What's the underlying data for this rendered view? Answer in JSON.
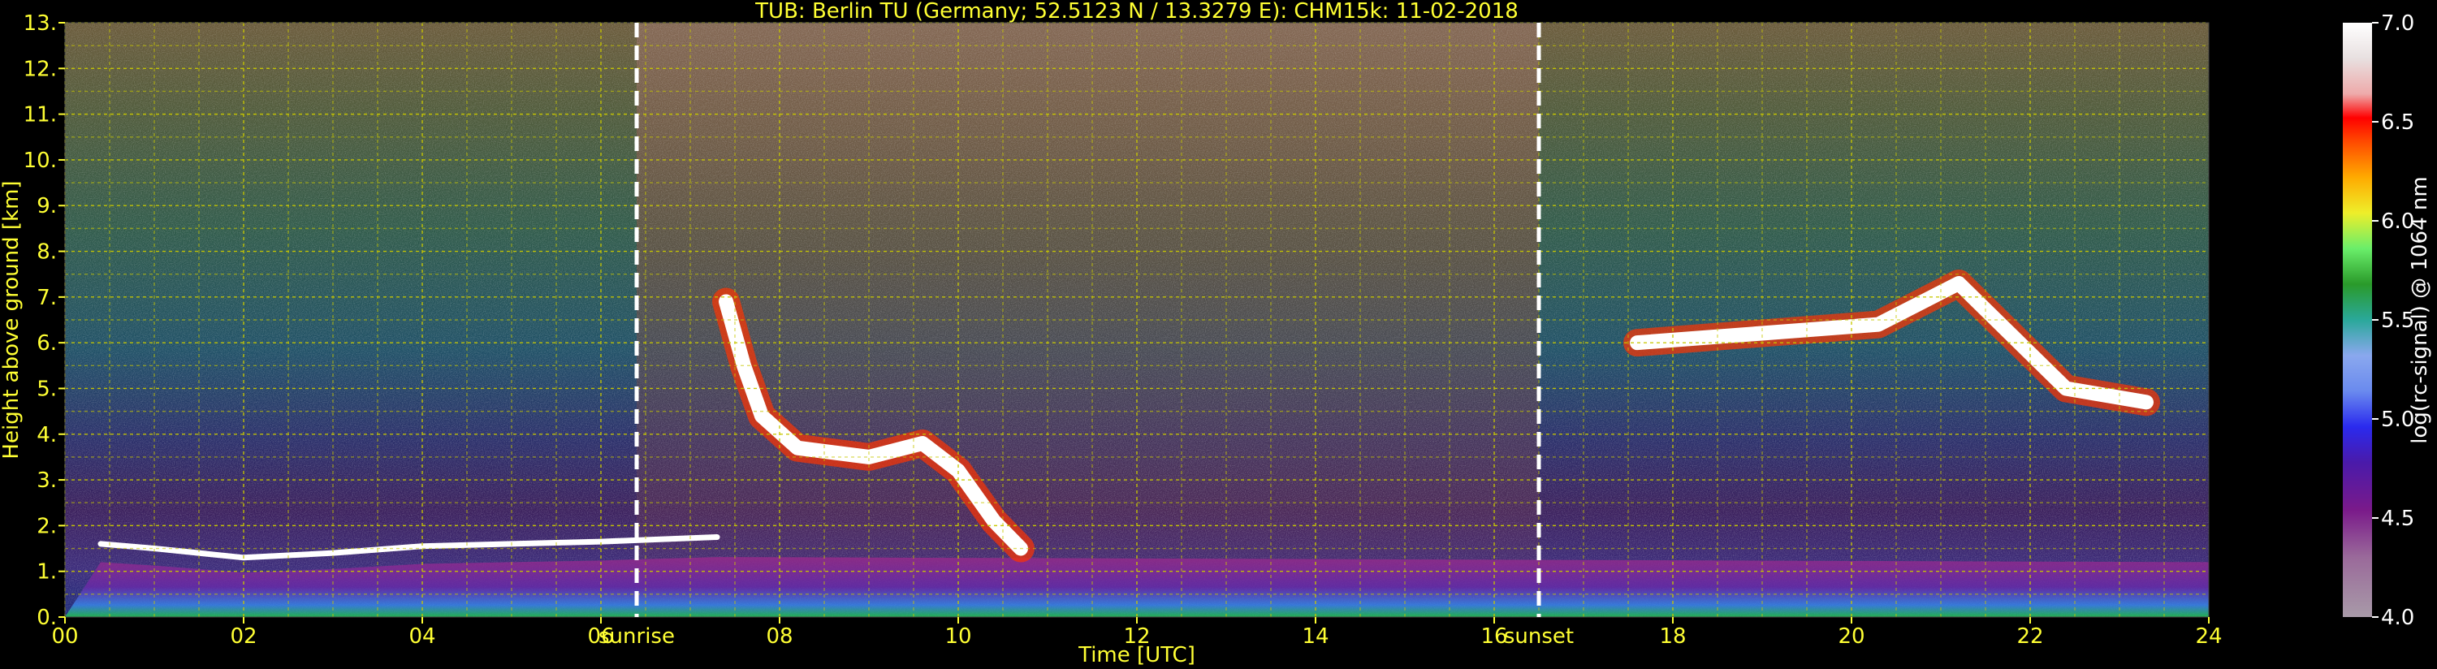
{
  "chart_data": {
    "type": "heatmap",
    "title": "TUB: Berlin TU (Germany; 52.5123 N / 13.3279 E):    CHM15k: 11-02-2018",
    "xlabel": "Time [UTC]",
    "ylabel": "Height above ground [km]",
    "xlim": [
      0,
      24
    ],
    "ylim": [
      0,
      13
    ],
    "x_ticks": [
      "00",
      "02",
      "04",
      "06",
      "08",
      "10",
      "12",
      "14",
      "16",
      "18",
      "20",
      "22",
      "24"
    ],
    "y_ticks": [
      "0.",
      "1.",
      "2.",
      "3.",
      "4.",
      "5.",
      "6.",
      "7.",
      "8.",
      "9.",
      "10.",
      "11.",
      "12.",
      "13."
    ],
    "grid": true,
    "events": [
      {
        "label": "sunrise",
        "time": 6.4
      },
      {
        "label": "sunset",
        "time": 16.5
      }
    ],
    "colorbar": {
      "label": "log(rc-signal) @ 1064 nm",
      "range": [
        4.0,
        7.0
      ],
      "ticks": [
        "4.0",
        "4.5",
        "5.0",
        "5.5",
        "6.0",
        "6.5",
        "7.0"
      ]
    },
    "features": [
      {
        "name": "boundary-layer-top",
        "points": [
          [
            0.4,
            1.6
          ],
          [
            1,
            1.5
          ],
          [
            2,
            1.3
          ],
          [
            3,
            1.4
          ],
          [
            4,
            1.55
          ],
          [
            5,
            1.6
          ],
          [
            6,
            1.65
          ],
          [
            7.3,
            1.75
          ]
        ]
      },
      {
        "name": "cloud-morning",
        "points": [
          [
            7.4,
            6.9
          ],
          [
            7.6,
            5.5
          ],
          [
            7.8,
            4.4
          ],
          [
            8.2,
            3.7
          ],
          [
            9,
            3.5
          ],
          [
            9.6,
            3.8
          ],
          [
            10.0,
            3.2
          ],
          [
            10.4,
            2.1
          ],
          [
            10.7,
            1.5
          ]
        ]
      },
      {
        "name": "cloud-evening",
        "points": [
          [
            17.6,
            6.0
          ],
          [
            20.3,
            6.4
          ],
          [
            21.2,
            7.3
          ],
          [
            22.4,
            5.0
          ],
          [
            23.3,
            4.7
          ]
        ]
      }
    ],
    "colors": {
      "axis_text": "#ffff33",
      "colorbar_text": "#ffffff",
      "grid": "#c8c800",
      "event_line": "#ffffff"
    }
  }
}
